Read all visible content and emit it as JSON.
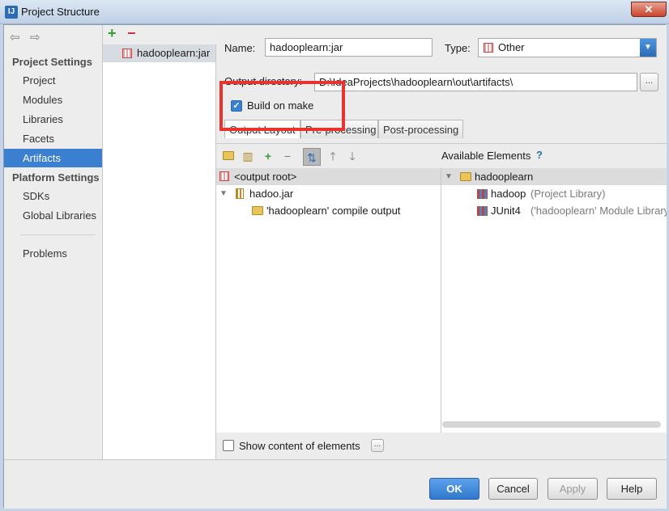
{
  "window": {
    "title": "Project Structure",
    "close_label": "✕"
  },
  "nav": {
    "back_icon": "⇦",
    "forward_icon": "⇨",
    "project_settings_header": "Project Settings",
    "project_settings_items": [
      {
        "label": "Project"
      },
      {
        "label": "Modules"
      },
      {
        "label": "Libraries"
      },
      {
        "label": "Facets"
      },
      {
        "label": "Artifacts",
        "selected": true
      }
    ],
    "platform_settings_header": "Platform Settings",
    "platform_settings_items": [
      {
        "label": "SDKs"
      },
      {
        "label": "Global Libraries"
      }
    ],
    "problems_label": "Problems"
  },
  "artifacts": {
    "add_label": "+",
    "remove_label": "−",
    "items": [
      {
        "label": "hadooplearn:jar"
      }
    ]
  },
  "config": {
    "name_label": "Name:",
    "name_value": "hadooplearn:jar",
    "type_label": "Type:",
    "type_value": "Other",
    "output_dir_label": "Output directory:",
    "output_dir_value": "D:\\IdeaProjects\\hadooplearn\\out\\artifacts\\",
    "browse_label": "...",
    "build_on_make_label": "Build on make",
    "build_on_make_checked": true,
    "tabs": [
      {
        "label": "Output Layout",
        "active": true
      },
      {
        "label": "Pre-processing"
      },
      {
        "label": "Post-processing"
      }
    ]
  },
  "layout": {
    "toolbar_icons": [
      "new-folder-icon",
      "archive-icon",
      "add-icon",
      "remove-icon",
      "sort-icon",
      "move-up-icon",
      "move-down-icon"
    ],
    "output_tree": [
      {
        "label": "<output root>",
        "level": 0
      },
      {
        "label": "hadoo.jar",
        "level": 1
      },
      {
        "label": "'hadooplearn' compile output",
        "level": 2
      }
    ],
    "available_header": "Available Elements",
    "help_label": "?",
    "available_tree": [
      {
        "label": "hadooplearn",
        "level": 0
      },
      {
        "label": "hadoop",
        "suffix": "(Project Library)",
        "level": 1
      },
      {
        "label": "JUnit4",
        "suffix": "('hadooplearn' Module Library)",
        "level": 1
      }
    ]
  },
  "footer": {
    "show_content_label": "Show content of elements",
    "show_content_checked": false,
    "more_label": "...",
    "ok_label": "OK",
    "cancel_label": "Cancel",
    "apply_label": "Apply",
    "help_label": "Help"
  }
}
